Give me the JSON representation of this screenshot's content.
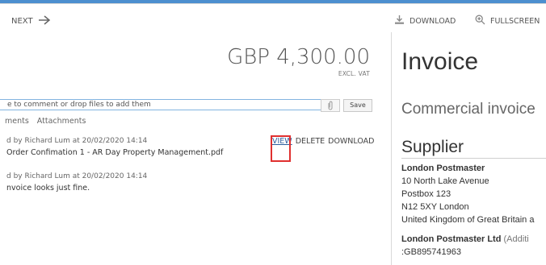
{
  "toolbar": {
    "next_label": "NEXT",
    "download_label": "DOWNLOAD",
    "fullscreen_label": "FULLSCREEN"
  },
  "totals": {
    "amount": "GBP 4,300.00",
    "vat_note": "EXCL. VAT"
  },
  "comment": {
    "input_value": "e to comment or drop files to add them",
    "save_label": "Save"
  },
  "tabs": [
    "ments",
    "Attachments"
  ],
  "entries": [
    {
      "meta": "d by Richard Lum at 20/02/2020 14:14",
      "text": "Order Confimation 1 - AR Day Property Management.pdf"
    },
    {
      "meta": "d by Richard Lum at 20/02/2020 14:14",
      "text": "nvoice looks just fine."
    }
  ],
  "attachment_actions": {
    "view": "VIEW",
    "delete": "DELETE",
    "download": "DOWNLOAD"
  },
  "document": {
    "title": "Invoice",
    "subtitle": "Commercial invoice",
    "supplier_heading": "Supplier",
    "supplier_name": "London Postmaster",
    "address": [
      "10 North Lake Avenue",
      "Postbox 123",
      "N12 5XY   London",
      "United Kingdom of Great Britain a"
    ],
    "legal_name": "London Postmaster Ltd",
    "legal_name_extra": " (Additi",
    "vat_number": ":GB895741963"
  },
  "colors": {
    "accent": "#4d8fcf",
    "highlight": "#e0302f"
  },
  "icons": [
    "arrow-right-icon",
    "download-icon",
    "zoom-icon",
    "paperclip-icon"
  ]
}
